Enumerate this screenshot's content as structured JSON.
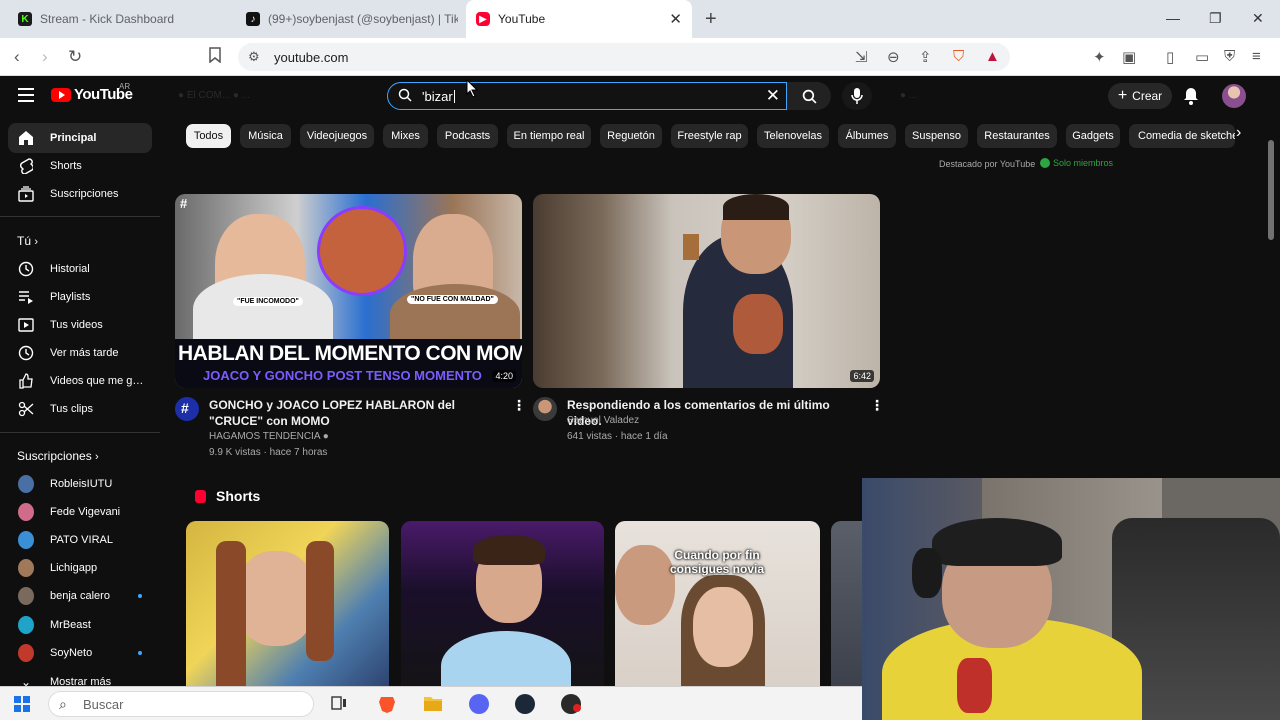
{
  "browser": {
    "tabs": [
      {
        "title": "Stream - Kick Dashboard",
        "icon": "kick-icon"
      },
      {
        "title": "(99+)soybenjast (@soybenjast) | TikTok",
        "icon": "tiktok-icon"
      },
      {
        "title": "YouTube",
        "icon": "youtube-icon",
        "active": true
      }
    ],
    "url": "youtube.com"
  },
  "youtube": {
    "logo_text": "YouTube",
    "country_code": "AR",
    "search_query": "'bizar",
    "create_label": "Crear"
  },
  "sidebar": {
    "main": [
      {
        "label": "Principal",
        "icon": "home-icon",
        "active": true
      },
      {
        "label": "Shorts",
        "icon": "shorts-icon"
      },
      {
        "label": "Suscripciones",
        "icon": "subscriptions-icon"
      }
    ],
    "you_heading": "Tú",
    "you": [
      {
        "label": "Historial",
        "icon": "history-icon"
      },
      {
        "label": "Playlists",
        "icon": "playlists-icon"
      },
      {
        "label": "Tus videos",
        "icon": "your-videos-icon"
      },
      {
        "label": "Ver más tarde",
        "icon": "watch-later-icon"
      },
      {
        "label": "Videos que me gu...",
        "icon": "liked-icon"
      },
      {
        "label": "Tus clips",
        "icon": "clips-icon"
      }
    ],
    "subs_heading": "Suscripciones",
    "subscriptions": [
      {
        "label": "RobleisIUTU",
        "color": "#4a6fa5"
      },
      {
        "label": "Fede Vigevani",
        "color": "#d06b8a"
      },
      {
        "label": "PATO VIRAL",
        "color": "#3b8fd6"
      },
      {
        "label": "Lichigapp",
        "color": "#a0785a"
      },
      {
        "label": "benja calero",
        "color": "#7a6a5e",
        "new": true
      },
      {
        "label": "MrBeast",
        "color": "#1fa3c9"
      },
      {
        "label": "SoyNeto",
        "color": "#c0392b",
        "new": true
      }
    ],
    "show_more": "Mostrar más"
  },
  "chips": [
    "Todos",
    "Música",
    "Videojuegos",
    "Mixes",
    "Podcasts",
    "En tiempo real",
    "Reguetón",
    "Freestyle rap",
    "Telenovelas",
    "Álbumes",
    "Suspenso",
    "Restaurantes",
    "Gadgets",
    "Comedia de sketche"
  ],
  "featured": {
    "label": "Destacado por YouTube",
    "members": "Solo miembros"
  },
  "videos": [
    {
      "title": "GONCHO y JOACO LOPEZ HABLARON del \"CRUCE\" con MOMO",
      "channel": "HAGAMOS TENDENCIA",
      "meta": "9.9 K vistas · hace 7 horas",
      "duration": "4:20",
      "thumb_text_1": "HABLAN DEL MOMENTO CON MOMO",
      "thumb_text_2": "JOACO Y GONCHO POST TENSO MOMENTO",
      "bubble_1": "\"FUE INCOMODO\"",
      "bubble_2": "\"NO FUE CON MALDAD\""
    },
    {
      "title": "Respondiendo a los comentarios de mi último video.",
      "channel": "Samuel Valadez",
      "meta": "641 vistas · hace 1 día",
      "duration": "6:42"
    }
  ],
  "shorts": {
    "heading": "Shorts",
    "items": [
      {
        "overlay": ""
      },
      {
        "overlay": ""
      },
      {
        "overlay": "Cuando por fin consigues novia"
      }
    ]
  },
  "taskbar": {
    "search_placeholder": "Buscar"
  }
}
